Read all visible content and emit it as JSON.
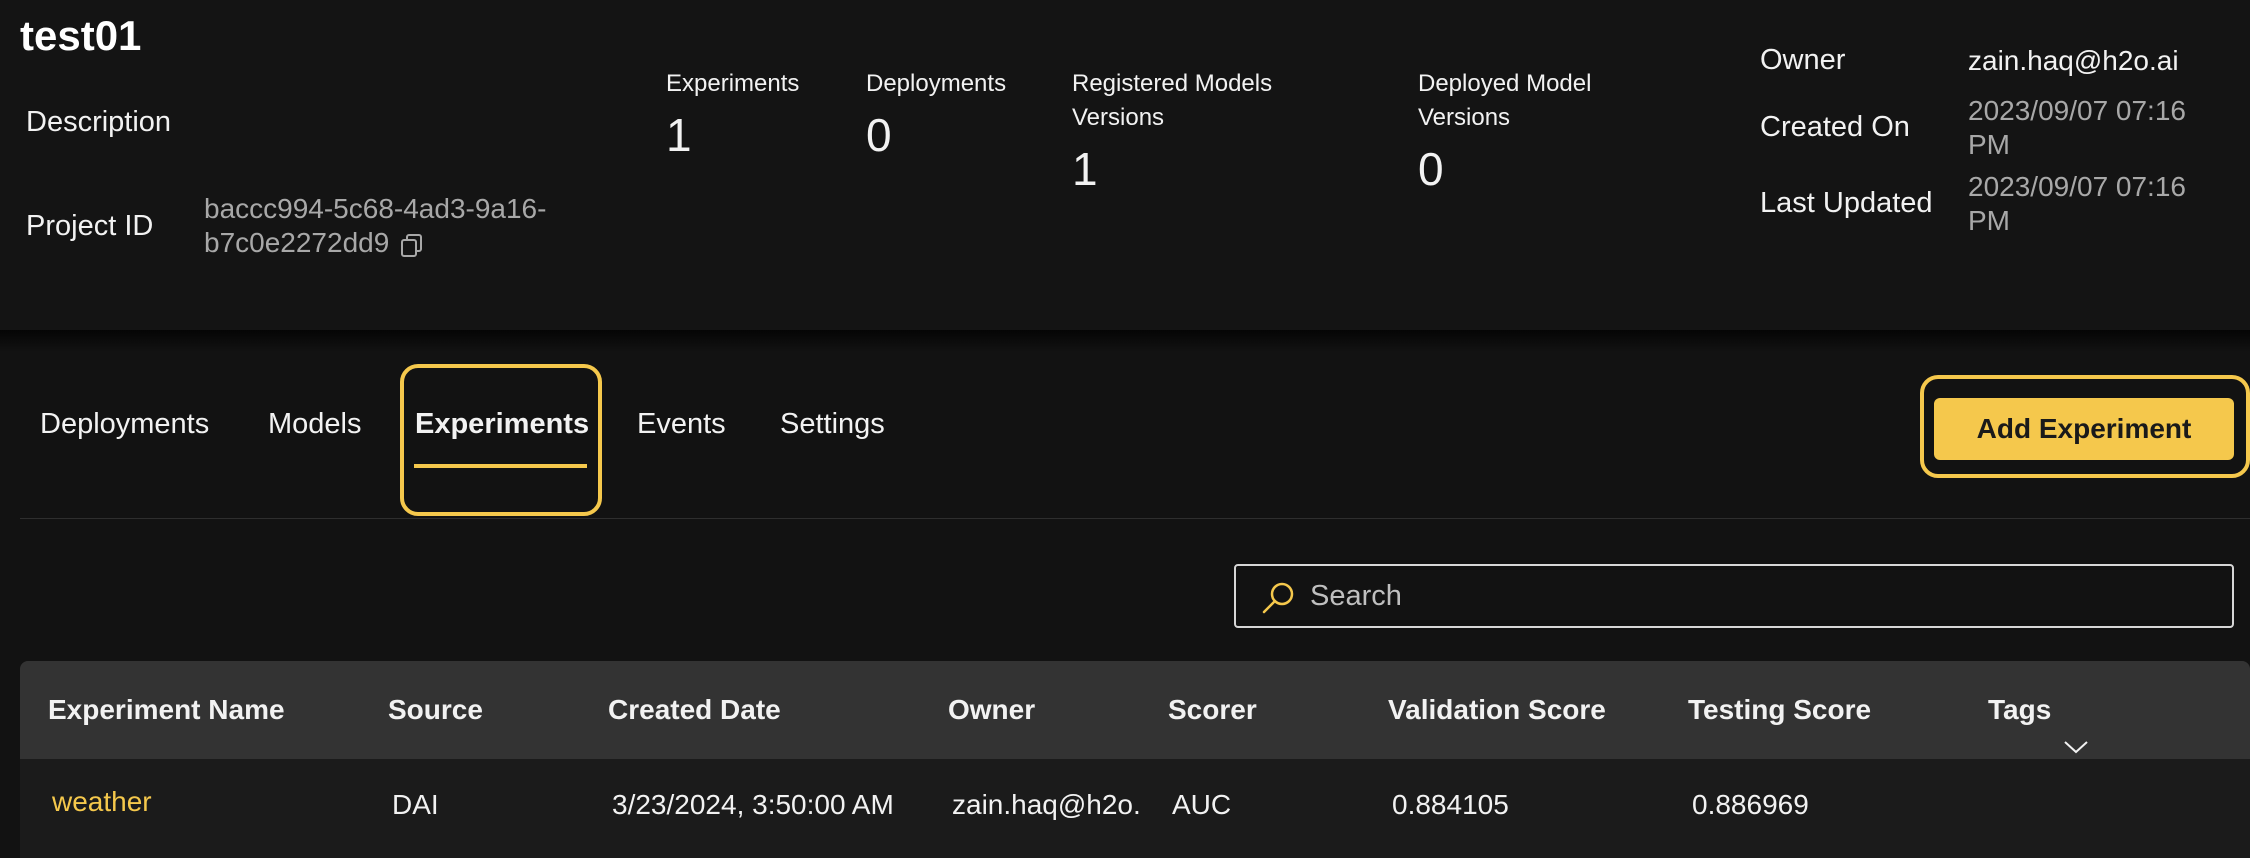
{
  "project": {
    "title": "test01",
    "description_label": "Description",
    "project_id_label": "Project ID",
    "project_id_line1": "baccc994-5c68-4ad3-9a16-",
    "project_id_line2": "b7c0e2272dd9"
  },
  "stats": {
    "experiments_label": "Experiments",
    "experiments_value": "1",
    "deployments_label": "Deployments",
    "deployments_value": "0",
    "registered_label_1": "Registered Models",
    "registered_label_2": "Versions",
    "registered_value": "1",
    "deployed_label_1": "Deployed Model",
    "deployed_label_2": "Versions",
    "deployed_value": "0"
  },
  "owner_info": {
    "owner_label": "Owner",
    "owner_value": "zain.haq@h2o.ai",
    "created_label": "Created On",
    "created_value_1": "2023/09/07 07:16",
    "created_value_2": "PM",
    "updated_label": "Last Updated",
    "updated_value_1": "2023/09/07 07:16",
    "updated_value_2": "PM"
  },
  "tabs": [
    {
      "label": "Deployments"
    },
    {
      "label": "Models"
    },
    {
      "label": "Experiments",
      "active": true
    },
    {
      "label": "Events"
    },
    {
      "label": "Settings"
    }
  ],
  "add_button_label": "Add Experiment",
  "search": {
    "placeholder": "Search"
  },
  "table": {
    "headers": [
      "Experiment Name",
      "Source",
      "Created Date",
      "Owner",
      "Scorer",
      "Validation Score",
      "Testing Score",
      "Tags"
    ],
    "rows": [
      [
        "weather",
        "DAI",
        "3/23/2024, 3:50:00 AM",
        "zain.haq@h2o.",
        "AUC",
        "0.884105",
        "0.886969",
        ""
      ]
    ]
  },
  "colors": {
    "accent": "#f5c84c",
    "background": "#121212",
    "table_header": "#333333"
  },
  "icons": [
    "copy-icon",
    "search-icon",
    "chevron-down-icon"
  ]
}
